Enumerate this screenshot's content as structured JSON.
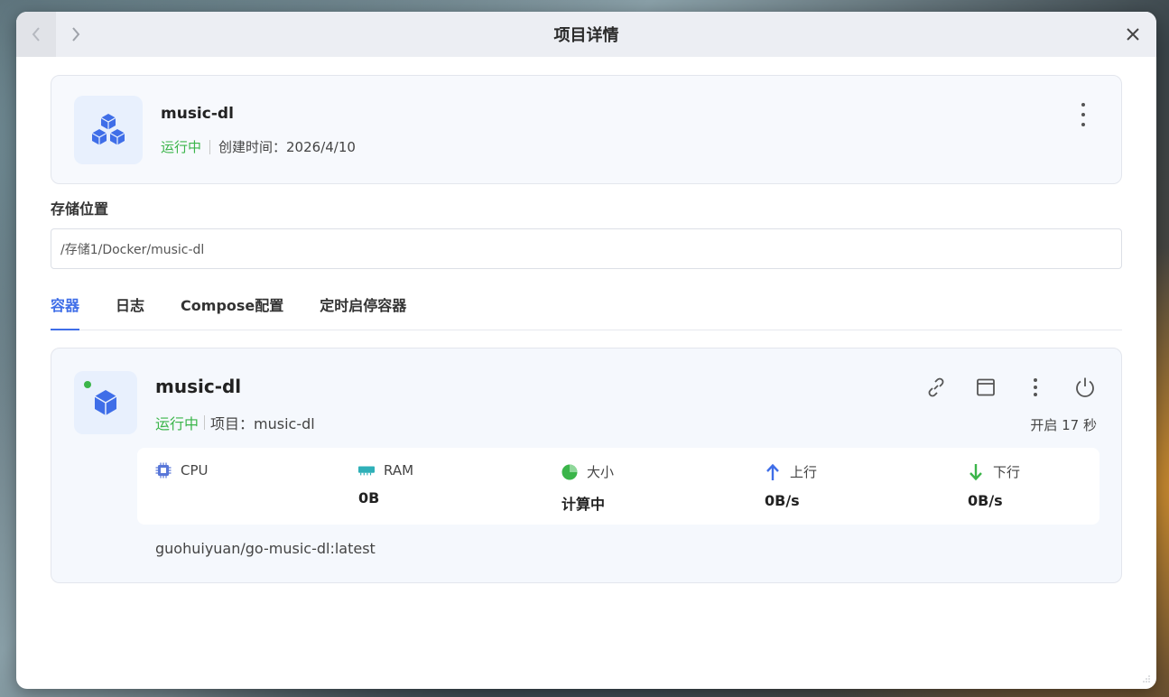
{
  "window": {
    "title": "项目详情"
  },
  "project": {
    "name": "music-dl",
    "status": "运行中",
    "created": "创建时间：2026/4/10"
  },
  "storage": {
    "label": "存储位置",
    "path": "/存储1/Docker/music-dl"
  },
  "tabs": [
    {
      "label": "容器",
      "active": true
    },
    {
      "label": "日志",
      "active": false
    },
    {
      "label": "Compose配置",
      "active": false
    },
    {
      "label": "定时启停容器",
      "active": false
    }
  ],
  "container": {
    "name": "music-dl",
    "status": "运行中",
    "project": "项目：music-dl",
    "uptime": "开启 17 秒",
    "image": "guohuiyuan/go-music-dl:latest",
    "stats": {
      "cpu": {
        "label": "CPU",
        "value": ""
      },
      "ram": {
        "label": "RAM",
        "value": "0B"
      },
      "size": {
        "label": "大小",
        "value": "计算中"
      },
      "up": {
        "label": "上行",
        "value": "0B/s"
      },
      "down": {
        "label": "下行",
        "value": "0B/s"
      }
    }
  },
  "colors": {
    "accent": "#3f6ee8",
    "running": "#3bb54a",
    "up_arrow": "#3f6ee8",
    "down_arrow": "#3bb54a"
  }
}
